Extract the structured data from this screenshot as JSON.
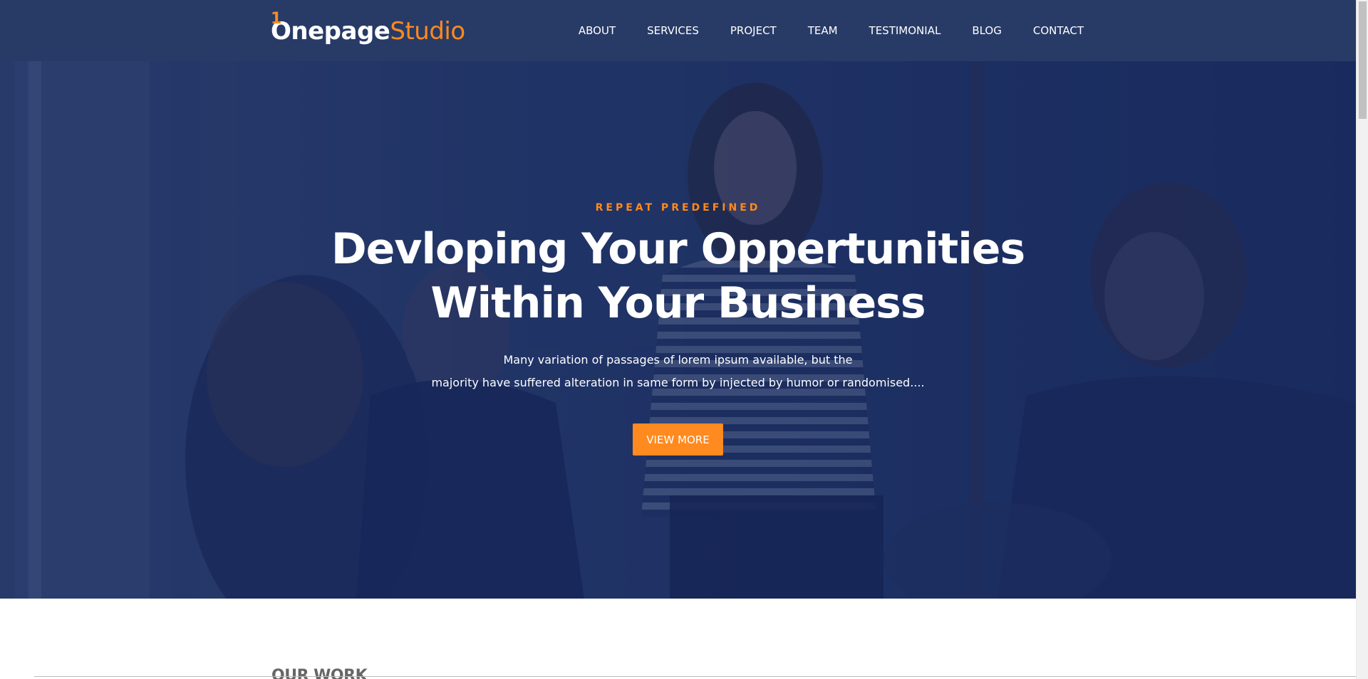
{
  "brand": {
    "mark_digit": "1",
    "mark_letter": "O",
    "name_part1": "nepage",
    "name_part2": "Studio"
  },
  "nav": {
    "items": [
      "ABOUT",
      "SERVICES",
      "PROJECT",
      "TEAM",
      "TESTIMONIAL",
      "BLOG",
      "CONTACT"
    ]
  },
  "hero": {
    "eyebrow": "REPEAT PREDEFINED",
    "headline_line1": "Devloping Your Oppertunities",
    "headline_line2": "Within Your Business",
    "sub_line1": "Many variation of passages of lorem ipsum available, but the",
    "sub_line2": "majority have suffered alteration in same form by injected by humor or randomised....",
    "cta_label": "VIEW MORE"
  },
  "next_section": {
    "label": "OUR WORK"
  },
  "colors": {
    "navbar_bg": "#283b66",
    "accent": "#ff8a1f",
    "hero_overlay": "#182a5e",
    "text_light": "#ffffff"
  }
}
